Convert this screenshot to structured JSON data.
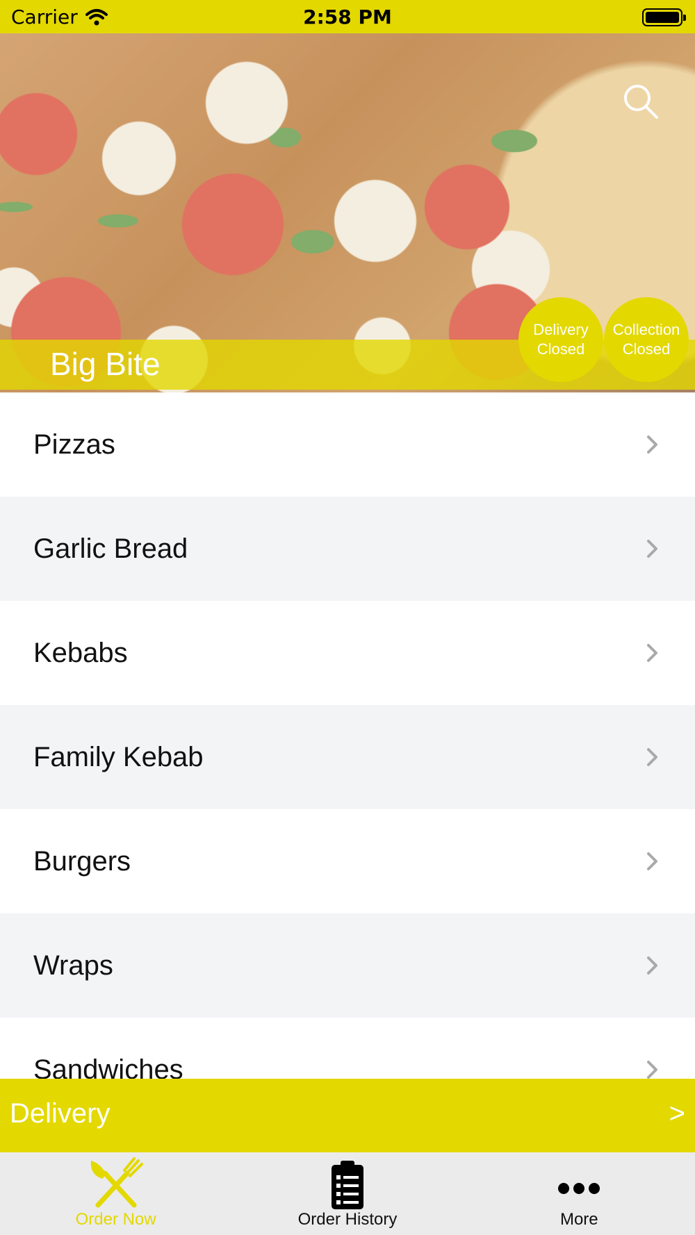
{
  "status_bar": {
    "carrier": "Carrier",
    "time": "2:58 PM"
  },
  "hero": {
    "store_name": "Big Bite",
    "delivery_badge": {
      "line1": "Delivery",
      "line2": "Closed"
    },
    "collection_badge": {
      "line1": "Collection",
      "line2": "Closed"
    }
  },
  "categories": [
    {
      "label": "Pizzas"
    },
    {
      "label": "Garlic Bread"
    },
    {
      "label": "Kebabs"
    },
    {
      "label": "Family Kebab"
    },
    {
      "label": "Burgers"
    },
    {
      "label": "Wraps"
    },
    {
      "label": "Sandwiches"
    }
  ],
  "delivery_bar": {
    "label": "Delivery",
    "arrow": ">"
  },
  "tabs": [
    {
      "label": "Order Now",
      "icon": "fork-knife-icon",
      "active": true
    },
    {
      "label": "Order History",
      "icon": "clipboard-list-icon",
      "active": false
    },
    {
      "label": "More",
      "icon": "more-dots-icon",
      "active": false
    }
  ],
  "colors": {
    "accent": "#e3d800",
    "row_alt": "#f3f4f6",
    "tab_bar": "#ebebeb"
  }
}
